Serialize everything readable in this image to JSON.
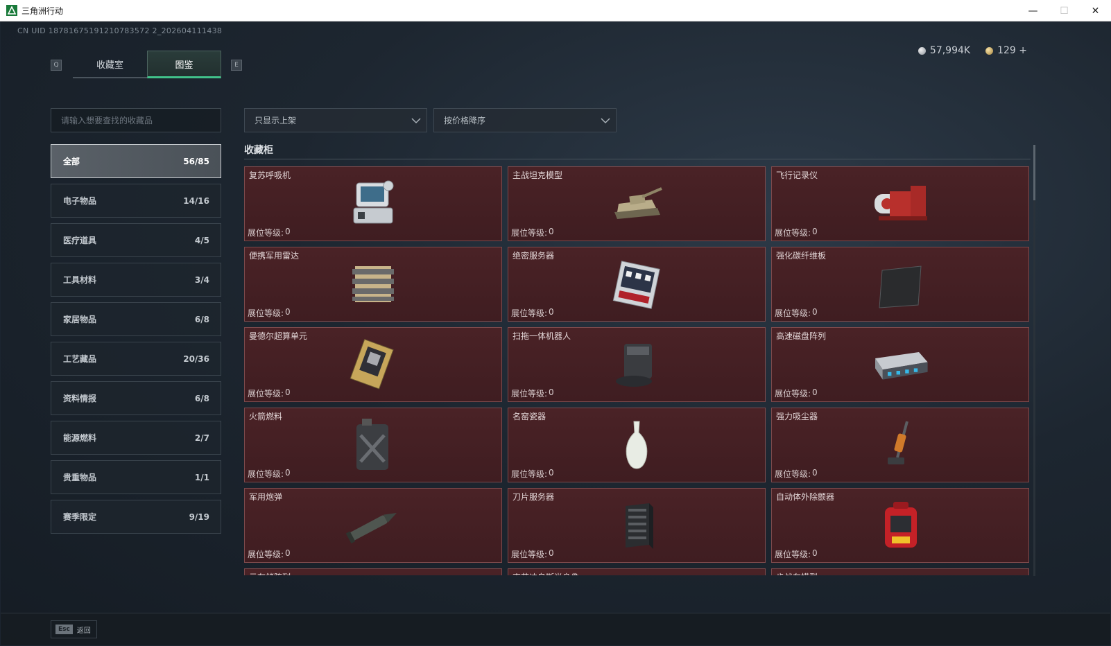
{
  "window": {
    "title": "三角洲行动",
    "controls": {
      "minimize": "—",
      "maximize": "☐",
      "close": "✕"
    }
  },
  "header": {
    "uid": "CN UID 18781675191210783572 2_202604111438",
    "currency": [
      {
        "icon": "silver-coin-icon",
        "value": "57,994K"
      },
      {
        "icon": "gold-coin-icon",
        "value": "129 +"
      }
    ]
  },
  "tabs": {
    "prev_hint": "Q",
    "next_hint": "E",
    "items": [
      {
        "label": "收藏室",
        "active": false
      },
      {
        "label": "图鉴",
        "active": true
      }
    ]
  },
  "search": {
    "placeholder": "请输入想要查找的收藏品"
  },
  "filters": {
    "shelf_filter": "只显示上架",
    "sort": "按价格降序"
  },
  "categories": [
    {
      "label": "全部",
      "count": "56/85",
      "active": true
    },
    {
      "label": "电子物品",
      "count": "14/16"
    },
    {
      "label": "医疗道具",
      "count": "4/5"
    },
    {
      "label": "工具材料",
      "count": "3/4"
    },
    {
      "label": "家居物品",
      "count": "6/8"
    },
    {
      "label": "工艺藏品",
      "count": "20/36"
    },
    {
      "label": "资料情报",
      "count": "6/8"
    },
    {
      "label": "能源燃料",
      "count": "2/7"
    },
    {
      "label": "贵重物品",
      "count": "1/1"
    },
    {
      "label": "赛季限定",
      "count": "9/19"
    }
  ],
  "section": {
    "title": "收藏柜"
  },
  "level_label": "展位等级:",
  "items": [
    {
      "name": "复苏呼吸机",
      "level": "0",
      "icon": "ventilator-icon"
    },
    {
      "name": "主战坦克模型",
      "level": "0",
      "icon": "tank-model-icon"
    },
    {
      "name": "飞行记录仪",
      "level": "0",
      "icon": "flight-recorder-icon"
    },
    {
      "name": "便携军用雷达",
      "level": "0",
      "icon": "radar-icon"
    },
    {
      "name": "绝密服务器",
      "level": "0",
      "icon": "server-board-icon"
    },
    {
      "name": "强化碳纤维板",
      "level": "0",
      "icon": "carbon-plate-icon"
    },
    {
      "name": "曼德尔超算单元",
      "level": "0",
      "icon": "supercomputer-icon"
    },
    {
      "name": "扫拖一体机器人",
      "level": "0",
      "icon": "robot-vacuum-icon"
    },
    {
      "name": "高速磁盘阵列",
      "level": "0",
      "icon": "disk-array-icon"
    },
    {
      "name": "火箭燃料",
      "level": "0",
      "icon": "fuel-can-icon"
    },
    {
      "name": "名窑瓷器",
      "level": "0",
      "icon": "porcelain-vase-icon"
    },
    {
      "name": "强力吸尘器",
      "level": "0",
      "icon": "vacuum-cleaner-icon"
    },
    {
      "name": "军用炮弹",
      "level": "0",
      "icon": "artillery-shell-icon"
    },
    {
      "name": "刀片服务器",
      "level": "0",
      "icon": "blade-server-icon"
    },
    {
      "name": "自动体外除颤器",
      "level": "0",
      "icon": "defibrillator-icon"
    },
    {
      "name": "云存储阵列",
      "level": "",
      "icon": ""
    },
    {
      "name": "克劳迪乌斯半身像",
      "level": "",
      "icon": ""
    },
    {
      "name": "步战车模型",
      "level": "",
      "icon": ""
    }
  ],
  "footer": {
    "esc_key": "Esc",
    "back_label": "返回"
  },
  "colors": {
    "accent": "#41c28a",
    "card_bg": "#4a2226",
    "card_border": "#7d4a4c"
  }
}
